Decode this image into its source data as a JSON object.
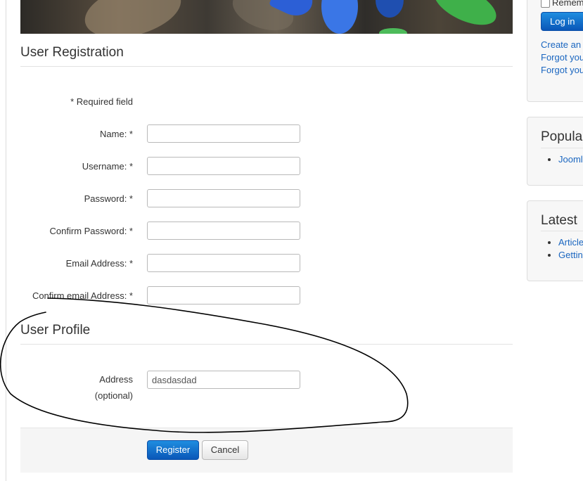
{
  "registration": {
    "title": "User Registration",
    "required_note": "* Required field",
    "fields": [
      {
        "label": "Name: *",
        "value": ""
      },
      {
        "label": "Username: *",
        "value": ""
      },
      {
        "label": "Password: *",
        "value": ""
      },
      {
        "label": "Confirm Password: *",
        "value": ""
      },
      {
        "label": "Email Address: *",
        "value": ""
      },
      {
        "label": "Confirm email Address: *",
        "value": ""
      }
    ]
  },
  "profile": {
    "title": "User Profile",
    "address_label": "Address",
    "address_optional": "(optional)",
    "address_value": "dasdasdad"
  },
  "actions": {
    "register_label": "Register",
    "cancel_label": "Cancel"
  },
  "sidebar": {
    "login": {
      "remember_label": "Remem",
      "login_label": "Log in",
      "links": [
        "Create an",
        "Forgot you",
        "Forgot you"
      ]
    },
    "popular": {
      "title": "Popula",
      "items": [
        "Jooml"
      ]
    },
    "latest": {
      "title": "Latest",
      "items": [
        "Article",
        "Gettin"
      ]
    }
  },
  "colors": {
    "primary_button": "#0a57b8",
    "link": "#1a66c0",
    "annotation_stroke": "#000000"
  },
  "icons": [
    "checkbox-icon",
    "bullet-icon"
  ]
}
